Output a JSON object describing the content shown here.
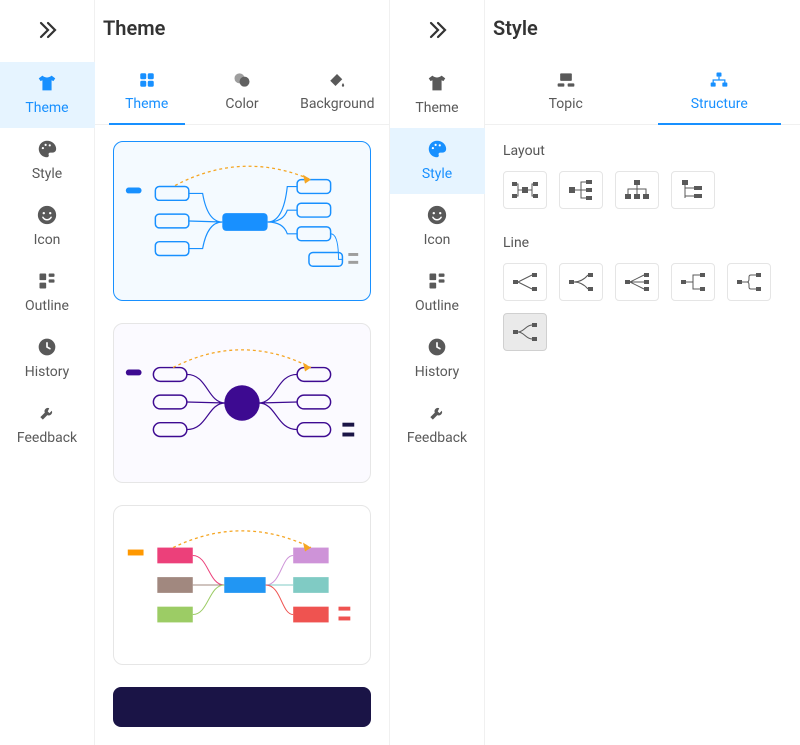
{
  "leftPanel": {
    "title": "Theme",
    "rail": {
      "items": [
        {
          "label": "Theme",
          "icon": "tshirt"
        },
        {
          "label": "Style",
          "icon": "palette"
        },
        {
          "label": "Icon",
          "icon": "smile"
        },
        {
          "label": "Outline",
          "icon": "outline"
        },
        {
          "label": "History",
          "icon": "clock"
        },
        {
          "label": "Feedback",
          "icon": "wrench"
        }
      ],
      "activeIndex": 0
    },
    "tabs": {
      "items": [
        {
          "label": "Theme",
          "icon": "grid"
        },
        {
          "label": "Color",
          "icon": "overlap"
        },
        {
          "label": "Background",
          "icon": "bucket"
        }
      ],
      "activeIndex": 0
    },
    "themes": [
      {
        "id": "blue-light",
        "selected": true
      },
      {
        "id": "purple-round",
        "selected": false
      },
      {
        "id": "colorful",
        "selected": false
      }
    ]
  },
  "rightPanel": {
    "title": "Style",
    "rail": {
      "items": [
        {
          "label": "Theme",
          "icon": "tshirt"
        },
        {
          "label": "Style",
          "icon": "palette"
        },
        {
          "label": "Icon",
          "icon": "smile"
        },
        {
          "label": "Outline",
          "icon": "outline"
        },
        {
          "label": "History",
          "icon": "clock"
        },
        {
          "label": "Feedback",
          "icon": "wrench"
        }
      ],
      "activeIndex": 1
    },
    "tabs": {
      "items": [
        {
          "label": "Topic",
          "icon": "topic"
        },
        {
          "label": "Structure",
          "icon": "structure"
        }
      ],
      "activeIndex": 1
    },
    "sections": {
      "layout": {
        "title": "Layout",
        "options": [
          "left-right",
          "right",
          "org",
          "tree-right"
        ],
        "selectedIndex": -1
      },
      "line": {
        "title": "Line",
        "options": [
          "angled-1",
          "angled-2",
          "straight",
          "elbow",
          "round-elbow",
          "curved"
        ],
        "selectedIndex": 5
      }
    }
  },
  "colors": {
    "accent": "#1890ff",
    "railActiveBg": "#e6f4ff",
    "grey": "#595959"
  }
}
